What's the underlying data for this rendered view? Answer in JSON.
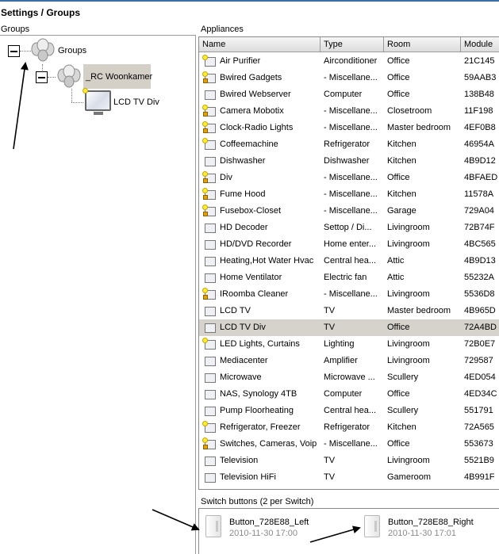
{
  "page": {
    "title": "Settings / Groups"
  },
  "groups": {
    "label": "Groups",
    "root": {
      "label": "Groups"
    },
    "group": {
      "label": "_RC Woonkamer"
    },
    "appliance": {
      "label": "LCD TV Div"
    }
  },
  "appliances": {
    "label": "Appliances",
    "columns": [
      "Name",
      "Type",
      "Room",
      "Module"
    ],
    "selected_index": 16,
    "rows": [
      {
        "name": "Air Purifier",
        "type": "Airconditioner",
        "room": "Office",
        "module": "21C145",
        "icon": "bulb"
      },
      {
        "name": "Bwired Gadgets",
        "type": "- Miscellane...",
        "room": "Office",
        "module": "59AAB3",
        "icon": "bulb-lock"
      },
      {
        "name": "Bwired Webserver",
        "type": "Computer",
        "room": "Office",
        "module": "138B48",
        "icon": "computer"
      },
      {
        "name": "Camera Mobotix",
        "type": "- Miscellane...",
        "room": "Closetroom",
        "module": "11F198",
        "icon": "bulb-lock"
      },
      {
        "name": "Clock-Radio Lights",
        "type": "- Miscellane...",
        "room": "Master bedroom",
        "module": "4EF0B8",
        "icon": "bulb-lock"
      },
      {
        "name": "Coffeemachine",
        "type": "Refrigerator",
        "room": "Kitchen",
        "module": "46954A",
        "icon": "bulb"
      },
      {
        "name": "Dishwasher",
        "type": "Dishwasher",
        "room": "Kitchen",
        "module": "4B9D12",
        "icon": "appliance"
      },
      {
        "name": "Div",
        "type": "- Miscellane...",
        "room": "Office",
        "module": "4BFAED",
        "icon": "bulb-lock"
      },
      {
        "name": "Fume Hood",
        "type": "- Miscellane...",
        "room": "Kitchen",
        "module": "11578A",
        "icon": "bulb-lock"
      },
      {
        "name": "Fusebox-Closet",
        "type": "- Miscellane...",
        "room": "Garage",
        "module": "729A04",
        "icon": "bulb-lock"
      },
      {
        "name": "HD Decoder",
        "type": "Settop / Di...",
        "room": "Livingroom",
        "module": "72B74F",
        "icon": "settop"
      },
      {
        "name": "HD/DVD Recorder",
        "type": "Home enter...",
        "room": "Livingroom",
        "module": "4BC565",
        "icon": "settop"
      },
      {
        "name": "Heating,Hot Water Hvac",
        "type": "Central hea...",
        "room": "Attic",
        "module": "4B9D13",
        "icon": "heater"
      },
      {
        "name": "Home Ventilator",
        "type": "Electric fan",
        "room": "Attic",
        "module": "55232A",
        "icon": "fan"
      },
      {
        "name": "IRoomba Cleaner",
        "type": "- Miscellane...",
        "room": "Livingroom",
        "module": "5536D8",
        "icon": "bulb-lock"
      },
      {
        "name": "LCD TV",
        "type": "TV",
        "room": "Master bedroom",
        "module": "4B965D",
        "icon": "tv"
      },
      {
        "name": "LCD TV Div",
        "type": "TV",
        "room": "Office",
        "module": "72A4BD",
        "icon": "tv"
      },
      {
        "name": "LED Lights, Curtains",
        "type": "Lighting",
        "room": "Livingroom",
        "module": "72B0E7",
        "icon": "bulb"
      },
      {
        "name": "Mediacenter",
        "type": "Amplifier",
        "room": "Livingroom",
        "module": "729587",
        "icon": "appliance"
      },
      {
        "name": "Microwave",
        "type": "Microwave ...",
        "room": "Scullery",
        "module": "4ED054",
        "icon": "appliance"
      },
      {
        "name": "NAS, Synology 4TB",
        "type": "Computer",
        "room": "Office",
        "module": "4ED34C",
        "icon": "computer"
      },
      {
        "name": "Pump Floorheating",
        "type": "Central hea...",
        "room": "Scullery",
        "module": "551791",
        "icon": "heater"
      },
      {
        "name": "Refrigerator, Freezer",
        "type": "Refrigerator",
        "room": "Kitchen",
        "module": "72A565",
        "icon": "bulb"
      },
      {
        "name": "Switches, Cameras, Voip",
        "type": "- Miscellane...",
        "room": "Office",
        "module": "553673",
        "icon": "bulb-lock"
      },
      {
        "name": "Television",
        "type": "TV",
        "room": "Livingroom",
        "module": "5521B9",
        "icon": "tv"
      },
      {
        "name": "Television HiFi",
        "type": "TV",
        "room": "Gameroom",
        "module": "4B991F",
        "icon": "tv"
      }
    ]
  },
  "switches": {
    "label": "Switch buttons (2 per Switch)",
    "buttons": [
      {
        "name": "Button_728E88_Left",
        "date": "2010-11-30 17:00"
      },
      {
        "name": "Button_728E88_Right",
        "date": "2010-11-30 17:01"
      }
    ]
  },
  "colors": {
    "selection": "#d6d3cc",
    "header": "#dcdcdc",
    "accent": "#3a6ea5"
  }
}
